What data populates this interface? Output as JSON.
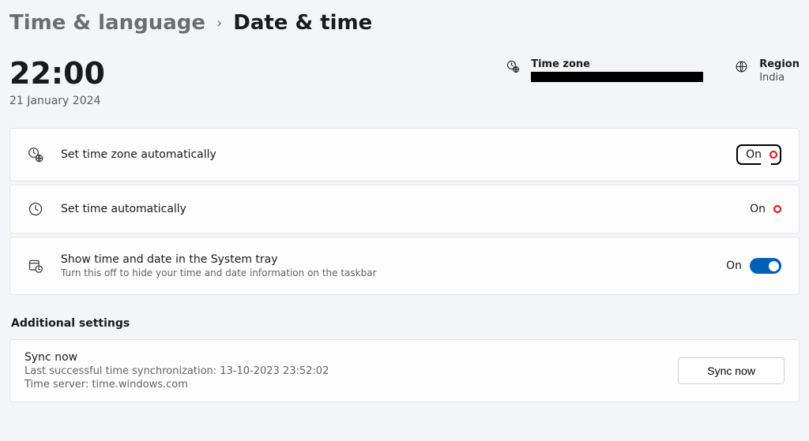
{
  "breadcrumb": {
    "parent": "Time & language",
    "current": "Date & time"
  },
  "clock": {
    "time": "22:00",
    "date": "21 January 2024"
  },
  "timezone": {
    "label": "Time zone",
    "value_redacted": true
  },
  "region": {
    "label": "Region",
    "value": "India"
  },
  "settings": {
    "auto_tz": {
      "title": "Set time zone automatically",
      "state": "On"
    },
    "auto_time": {
      "title": "Set time automatically",
      "state": "On"
    },
    "tray": {
      "title": "Show time and date in the System tray",
      "sub": "Turn this off to hide your time and date information on the taskbar",
      "state": "On"
    }
  },
  "additional": {
    "heading": "Additional settings",
    "sync": {
      "title": "Sync now",
      "last": "Last successful time synchronization: 13-10-2023 23:52:02",
      "server": "Time server: time.windows.com",
      "button": "Sync now"
    }
  }
}
